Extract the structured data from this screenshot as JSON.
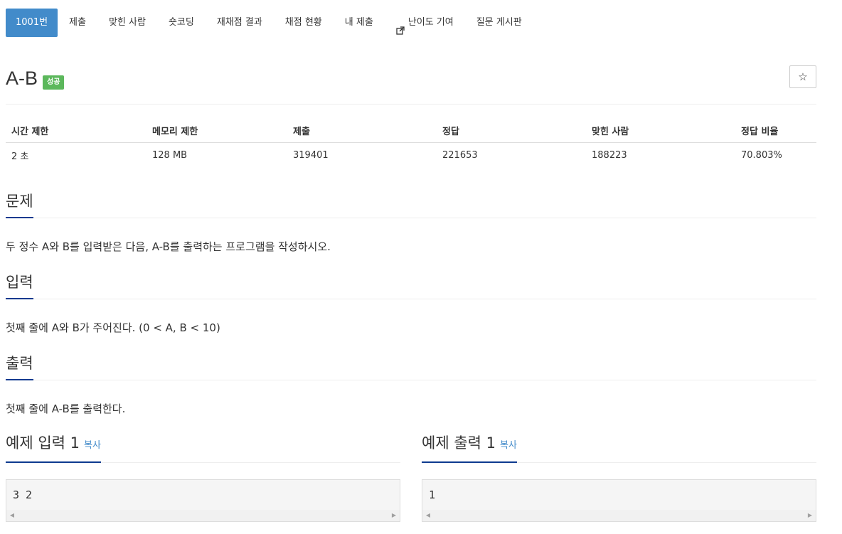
{
  "nav": {
    "items": [
      {
        "label": "1001번",
        "active": true
      },
      {
        "label": "제출"
      },
      {
        "label": "맞힌 사람"
      },
      {
        "label": "숏코딩"
      },
      {
        "label": "재채점 결과"
      },
      {
        "label": "채점 현황"
      },
      {
        "label": "내 제출"
      },
      {
        "label": "난이도 기여",
        "icon": "external-link-icon"
      },
      {
        "label": "질문 게시판"
      }
    ]
  },
  "problem": {
    "title": "A-B",
    "badge": "성공",
    "star": "☆"
  },
  "info": {
    "headers": [
      "시간 제한",
      "메모리 제한",
      "제출",
      "정답",
      "맞힌 사람",
      "정답 비율"
    ],
    "values": [
      "2 초",
      "128 MB",
      "319401",
      "221653",
      "188223",
      "70.803%"
    ]
  },
  "sections": {
    "description": {
      "title": "문제",
      "text": "두 정수 A와 B를 입력받은 다음, A-B를 출력하는 프로그램을 작성하시오."
    },
    "input": {
      "title": "입력",
      "text": "첫째 줄에 A와 B가 주어진다. (0 < A, B < 10)"
    },
    "output": {
      "title": "출력",
      "text": "첫째 줄에 A-B를 출력한다."
    }
  },
  "samples": {
    "input": {
      "title": "예제 입력 1",
      "copy": "복사",
      "content": "3 2"
    },
    "output": {
      "title": "예제 출력 1",
      "copy": "복사",
      "content": "1"
    }
  },
  "colors": {
    "accent": "#428bca",
    "success": "#5cb85c",
    "underline": "#0d3a8f"
  }
}
